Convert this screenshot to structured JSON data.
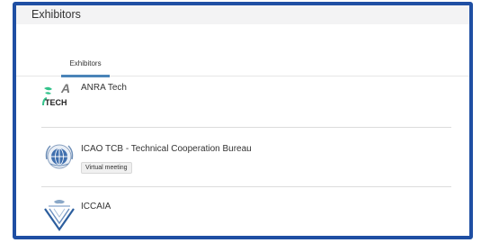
{
  "header": {
    "title": "Exhibitors"
  },
  "tabs": [
    {
      "label": "Exhibitors",
      "active": true
    }
  ],
  "exhibitors": [
    {
      "name": "ANRA Tech",
      "logo": "anra-tech-logo",
      "logo_text_1": "A",
      "logo_text_2": "TECH"
    },
    {
      "name": "ICAO TCB - Technical Cooperation Bureau",
      "logo": "icao-emblem-logo",
      "badge": "Virtual meeting"
    },
    {
      "name": "ICCAIA",
      "logo": "iccaia-logo"
    }
  ],
  "colors": {
    "frame_border": "#1f4fa3",
    "tab_underline": "#4a84b8",
    "header_bg": "#f3f3f4",
    "anra_green": "#33c38b"
  }
}
